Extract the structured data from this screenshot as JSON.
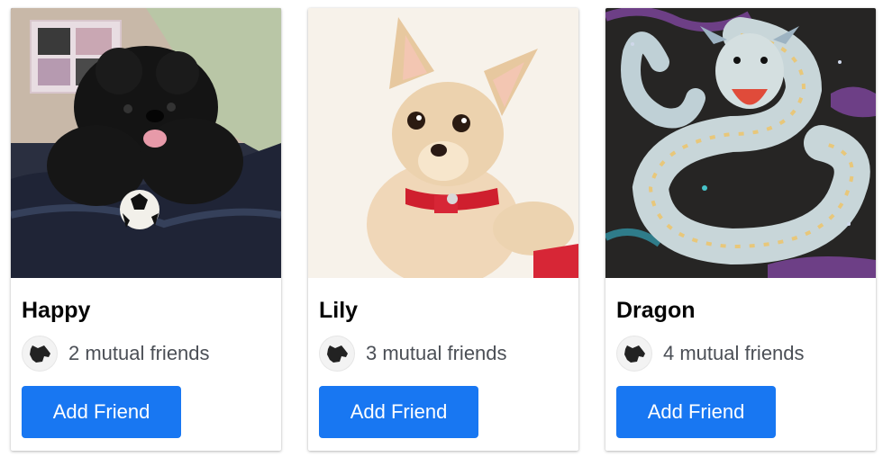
{
  "accent_color": "#1877f2",
  "cards": [
    {
      "name": "Happy",
      "mutual_friends": "2 mutual friends",
      "button_label": "Add Friend",
      "photo_icon": "black-poodle-photo"
    },
    {
      "name": "Lily",
      "mutual_friends": "3 mutual friends",
      "button_label": "Add Friend",
      "photo_icon": "chihuahua-photo"
    },
    {
      "name": "Dragon",
      "mutual_friends": "4 mutual friends",
      "button_label": "Add Friend",
      "photo_icon": "serpent-dragon-artwork"
    }
  ]
}
